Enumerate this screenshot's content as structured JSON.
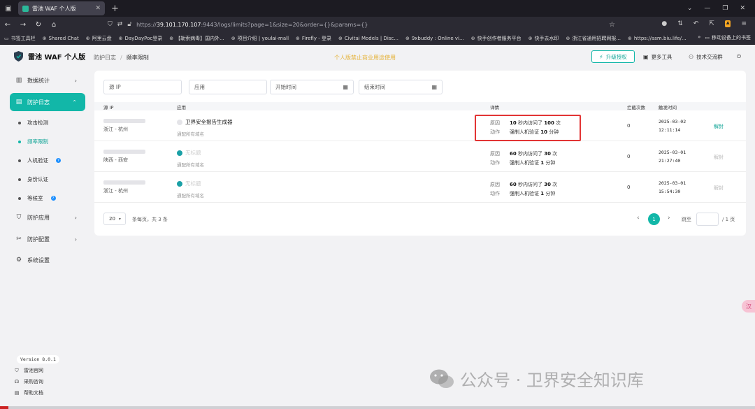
{
  "browser": {
    "tab_title": "雷池 WAF 个人版",
    "url_prefix": "https://",
    "url_host": "39.101.170.107",
    "url_rest": ":9443/logs/limits?page=1&size=20&order={}&params={}",
    "bookmarks": [
      "书签工具栏",
      "Shared Chat",
      "阿里云盘",
      "DayDayPoc登录",
      "【勒索病毒】国内外...",
      "项目介绍 | youlai-mall",
      "Firefly - 登录",
      "Civitai Models | Disc...",
      "9xbuddy : Online vi...",
      "快手创作者服务平台",
      "快手去水印",
      "浙江省通用招聘网报...",
      "https://asm.biu.life/..."
    ],
    "bookmarks_right": "移动设备上的书签"
  },
  "sidebar": {
    "logo": "雷池 WAF 个人版",
    "menu": [
      {
        "label": "数据统计",
        "icon": "bar-chart-icon"
      },
      {
        "label": "防护日志",
        "icon": "log-icon"
      },
      {
        "label": "防护应用",
        "icon": "shield-icon"
      },
      {
        "label": "防护配置",
        "icon": "tools-icon"
      },
      {
        "label": "系统设置",
        "icon": "gear-icon"
      }
    ],
    "submenu": [
      "攻击检测",
      "频率限制",
      "人机验证",
      "身份认证",
      "等候室"
    ],
    "version": "Version 8.0.1",
    "footer_links": [
      "雷池官网",
      "采购咨询",
      "帮助文档"
    ]
  },
  "header": {
    "breadcrumb_parent": "防护日志",
    "breadcrumb_current": "频率限制",
    "notice": "个人版禁止商业用途使用",
    "upgrade_button": "升级授权",
    "more_tools": "更多工具",
    "community": "技术交流群"
  },
  "filters": {
    "source_ip": "源 IP",
    "app": "应用",
    "start_time": "开始时间",
    "end_time": "结束时间"
  },
  "table": {
    "headers": [
      "源 IP",
      "应用",
      "详情",
      "拦截次数",
      "触发时间"
    ],
    "reason_label": "原因",
    "action_label": "动作",
    "rows": [
      {
        "location": "浙江 - 杭州",
        "app": "卫界安全报告生成器",
        "domain": "通配所有域名",
        "reason_pre": "10",
        "reason_mid": " 秒内访问了 ",
        "reason_num": "100",
        "reason_post": " 次",
        "action_pre": "强制人机验证 ",
        "action_num": "10",
        "action_post": " 分钟",
        "count": "0",
        "date": "2025-03-02",
        "time": "12:11:14",
        "op": "解封"
      },
      {
        "location": "陕西 - 西安",
        "app": "无标题",
        "domain": "通配所有域名",
        "reason_pre": "60",
        "reason_mid": " 秒内访问了 ",
        "reason_num": "30",
        "reason_post": " 次",
        "action_pre": "强制人机验证 ",
        "action_num": "1",
        "action_post": " 分钟",
        "count": "0",
        "date": "2025-03-01",
        "time": "21:27:40",
        "op": "解封"
      },
      {
        "location": "浙江 - 杭州",
        "app": "无标题",
        "domain": "通配所有域名",
        "reason_pre": "60",
        "reason_mid": " 秒内访问了 ",
        "reason_num": "30",
        "reason_post": " 次",
        "action_pre": "强制人机验证 ",
        "action_num": "1",
        "action_post": " 分钟",
        "count": "0",
        "date": "2025-03-01",
        "time": "15:54:30",
        "op": "解封"
      }
    ]
  },
  "pagination": {
    "page_size": "20",
    "summary": "条每页，共 3 条",
    "current": "1",
    "jump_label": "跳至",
    "total_pages": "/ 1 页"
  },
  "float_tag": "汉",
  "watermark": "公众号 · 卫界安全知识库",
  "colors": {
    "accent": "#12b7a8",
    "notice": "#e5b33a",
    "highlight": "#e23434"
  }
}
